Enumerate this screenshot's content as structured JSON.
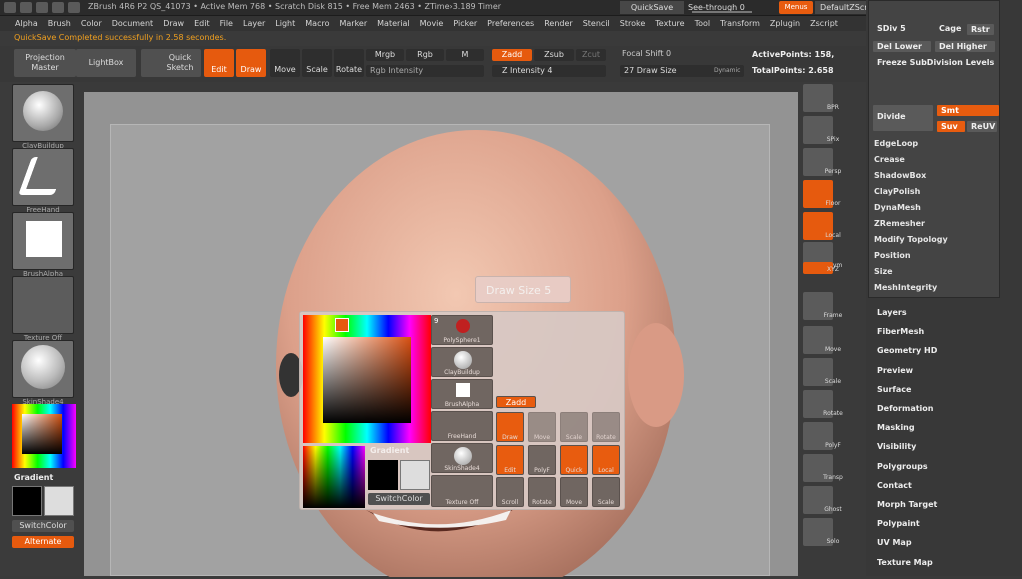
{
  "titlebar": {
    "text": "ZBrush 4R6 P2   QS_41073   • Active Mem 768 • Scratch Disk 815 • Free Mem 2463 • ZTime›3.189 Timer",
    "quicksave": "QuickSave",
    "seethrough": "See-through  0",
    "menus": "Menus",
    "default_script": "DefaultZScript"
  },
  "menu": [
    "Alpha",
    "Brush",
    "Color",
    "Document",
    "Draw",
    "Edit",
    "File",
    "Layer",
    "Light",
    "Macro",
    "Marker",
    "Material",
    "Movie",
    "Picker",
    "Preferences",
    "Render",
    "Stencil",
    "Stroke",
    "Texture",
    "Tool",
    "Transform",
    "Zplugin",
    "Zscript"
  ],
  "status": "QuickSave Completed successfully in 2.58 secondes.",
  "toolbar": {
    "projection": "Projection Master",
    "lightbox": "LightBox",
    "quicksketch": "Quick Sketch",
    "edit": "Edit",
    "draw": "Draw",
    "move": "Move",
    "scale": "Scale",
    "rotate": "Rotate",
    "mrgb": "Mrgb",
    "rgb": "Rgb",
    "m": "M",
    "zadd": "Zadd",
    "zsub": "Zsub",
    "zcut": "Zcut",
    "rgb_intensity": "Rgb Intensity",
    "z_intensity": "Z Intensity 4",
    "focal_shift": "Focal Shift 0",
    "draw_size": "27 Draw Size",
    "dynamic": "Dynamic",
    "active_points": "ActivePoints: 158,",
    "total_points": "TotalPoints: 2.658"
  },
  "left_shelf": {
    "thumbs": [
      "ClayBuildup",
      "FreeHand",
      "BrushAlpha",
      "Texture Off",
      "SkinShade4"
    ],
    "gradient": "Gradient",
    "switchcolor": "SwitchColor",
    "alternate": "Alternate"
  },
  "right_shelf": [
    "BPR",
    "SPix",
    "Persp",
    "Floor",
    "Local",
    "L.Sym",
    "XYZ",
    "Frame",
    "Move",
    "Scale",
    "Rotate",
    "PolyF",
    "Transp",
    "Ghost",
    "Solo"
  ],
  "subtool": {
    "sdiv": "SDiv 5",
    "cage": "Cage",
    "rstr": "Rstr",
    "del_lower": "Del Lower",
    "del_higher": "Del Higher",
    "freeze": "Freeze SubDivision Levels",
    "divide": "Divide",
    "smt": "Smt",
    "suv": "Suv",
    "reuv": "ReUV",
    "items": [
      "EdgeLoop",
      "Crease",
      "ShadowBox",
      "ClayPolish",
      "DynaMesh",
      "ZRemesher",
      "Modify Topology",
      "Position",
      "Size",
      "MeshIntegrity"
    ]
  },
  "tool_menu": [
    "Layers",
    "FiberMesh",
    "Geometry HD",
    "Preview",
    "Surface",
    "Deformation",
    "Masking",
    "Visibility",
    "Polygroups",
    "Contact",
    "Morph Target",
    "Polypaint",
    "UV Map",
    "Texture Map"
  ],
  "popup": {
    "drawsize_tip": "Draw Size  5",
    "poly": "PolySphere1",
    "clay": "ClayBuildup",
    "alpha": "BrushAlpha",
    "freehand": "FreeHand",
    "skin": "SkinShade4",
    "texoff": "Texture Off",
    "gradient": "Gradient",
    "switchcolor": "SwitchColor",
    "zadd": "Zadd",
    "draw": "Draw",
    "move": "Move",
    "scale": "Scale",
    "rotate": "Rotate",
    "edit": "Edit",
    "polyf": "PolyF",
    "quick": "Quick",
    "local": "Local",
    "scroll": "Scroll",
    "rotate2": "Rotate",
    "move2": "Move",
    "scale2": "Scale",
    "count": "9"
  }
}
